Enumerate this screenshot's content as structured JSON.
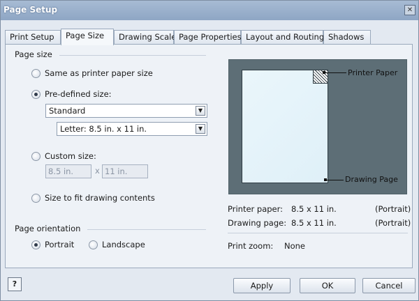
{
  "window": {
    "title": "Page Setup",
    "close_glyph": "✕"
  },
  "tabs": [
    {
      "label": "Print Setup"
    },
    {
      "label": "Page Size"
    },
    {
      "label": "Drawing Scale"
    },
    {
      "label": "Page Properties"
    },
    {
      "label": "Layout and Routing"
    },
    {
      "label": "Shadows"
    }
  ],
  "active_tab": "Page Size",
  "page_size": {
    "group_label": "Page size",
    "option_printer": "Same as printer paper size",
    "option_predefined": "Pre-defined size:",
    "predefined_category": "Standard",
    "predefined_size": "Letter:  8.5 in. x 11 in.",
    "option_custom": "Custom size:",
    "custom_width": "8.5 in.",
    "custom_x": "x",
    "custom_height": "11 in.",
    "option_fit": "Size to fit drawing contents",
    "selected": "predefined"
  },
  "orientation": {
    "group_label": "Page orientation",
    "portrait": "Portrait",
    "landscape": "Landscape",
    "selected": "portrait"
  },
  "preview": {
    "printer_paper_label": "Printer Paper",
    "drawing_page_label": "Drawing Page",
    "background_color": "#5d6e76"
  },
  "info": {
    "printer_paper_label": "Printer paper:",
    "printer_paper_value": "8.5 x 11 in.",
    "printer_paper_orient": "(Portrait)",
    "drawing_page_label": "Drawing page:",
    "drawing_page_value": "8.5 x 11 in.",
    "drawing_page_orient": "(Portrait)",
    "print_zoom_label": "Print zoom:",
    "print_zoom_value": "None"
  },
  "buttons": {
    "help": "?",
    "apply": "Apply",
    "ok": "OK",
    "cancel": "Cancel"
  }
}
